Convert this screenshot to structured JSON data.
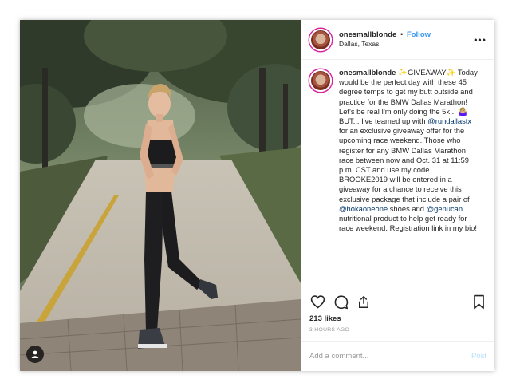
{
  "post": {
    "username": "onesmallblonde",
    "dot": "•",
    "follow_label": "Follow",
    "location": "Dallas, Texas",
    "more_label": "•••"
  },
  "caption": {
    "username": "onesmallblonde",
    "sparkle": "✨",
    "giveaway": "GIVEAWAY",
    "text_1": "Today would be the perfect day with these 45 degree temps to get my butt outside and practice for the BMW Dallas Marathon! Let's be real I'm only doing the 5k... ",
    "emoji_text": "🤷🏼‍♀️",
    "text_2": " BUT... I've teamed up with ",
    "mention_1": "@rundallastx",
    "text_3": " for an exclusive giveaway offer for the upcoming race weekend. Those who register for any BMW Dallas Marathon race between now and Oct. 31 at 11:59 p.m. CST and use my code BROOKE2019 will be entered in a giveaway for a chance to receive this exclusive package that include a pair of ",
    "mention_2": "@hokaoneone",
    "text_4": " shoes and ",
    "mention_3": "@genucan",
    "text_5": " nutritional product to help get ready for race weekend. Registration link in my bio!"
  },
  "stats": {
    "likes": "213 likes",
    "time_ago": "3 HOURS AGO"
  },
  "comment_box": {
    "placeholder": "Add a comment...",
    "post_label": "Post"
  },
  "icons": {
    "like": "heart-icon",
    "comment": "comment-icon",
    "share": "share-icon",
    "save": "bookmark-icon",
    "tags": "user-tag-icon"
  },
  "colors": {
    "follow": "#3897f0",
    "mention": "#003569",
    "post_disabled": "#b2dffc",
    "timestamp": "#999999"
  }
}
